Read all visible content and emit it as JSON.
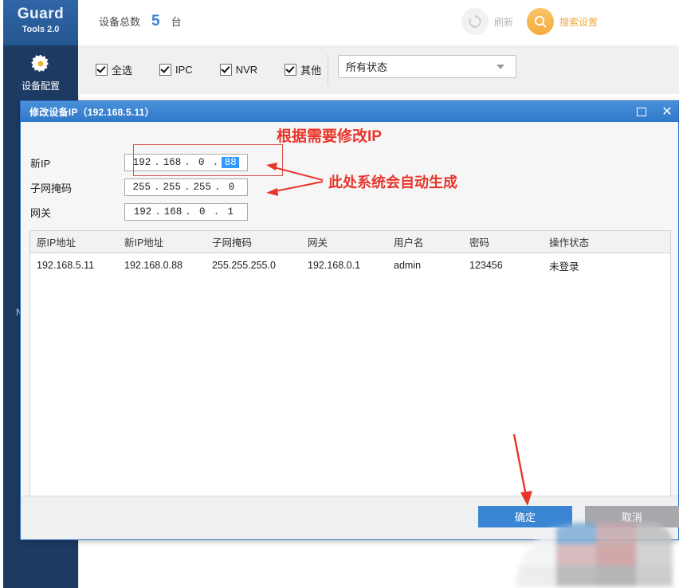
{
  "brand": {
    "title": "Guard",
    "subtitle": "Tools 2.0"
  },
  "header": {
    "device_count_label": "设备总数",
    "device_count_value": "5",
    "device_count_unit": "台",
    "refresh_label": "刷新",
    "search_setting_label": "搜索设置",
    "refresh_icon": "refresh-circular-arrow-icon",
    "search_icon": "search-settings-icon",
    "accent_blue": "#3a86d4",
    "accent_orange": "#f0a93c"
  },
  "sidebar": {
    "items": [
      {
        "label": "设备配置",
        "icon": "gear-icon"
      }
    ],
    "ghost_text": "NV",
    "background": "#1d3a63"
  },
  "filter_bar": {
    "checkboxes": [
      {
        "label": "全选",
        "checked": true
      },
      {
        "label": "IPC",
        "checked": true
      },
      {
        "label": "NVR",
        "checked": true
      },
      {
        "label": "其他",
        "checked": true
      }
    ],
    "status_select": {
      "value": "所有状态",
      "caret_icon": "chevron-down-icon"
    }
  },
  "dialog": {
    "title": "修改设备IP（192.168.5.11）",
    "titlebar_color": "#3b86d4",
    "window_controls": [
      {
        "name": "maximize",
        "icon": "maximize-icon"
      },
      {
        "name": "close",
        "icon": "close-icon"
      }
    ],
    "form": {
      "new_ip": {
        "label": "新IP",
        "octets": [
          "192",
          "168",
          "0",
          "88"
        ],
        "selected_octet_index": 3
      },
      "subnet_mask": {
        "label": "子网掩码",
        "octets": [
          "255",
          "255",
          "255",
          "0"
        ]
      },
      "gateway": {
        "label": "网关",
        "octets": [
          "192",
          "168",
          "0",
          "1"
        ]
      }
    },
    "table": {
      "columns": [
        "原IP地址",
        "新IP地址",
        "子网掩码",
        "网关",
        "用户名",
        "密码",
        "操作状态"
      ],
      "rows": [
        {
          "original_ip": "192.168.5.11",
          "new_ip": "192.168.0.88",
          "subnet_mask": "255.255.255.0",
          "gateway": "192.168.0.1",
          "username": "admin",
          "password": "123456",
          "status": "未登录"
        }
      ]
    },
    "footer": {
      "ok_label": "确定",
      "cancel_label": "取消",
      "ok_color": "#3b86d4",
      "cancel_color": "#a6a8ab"
    }
  },
  "annotations": {
    "color": "#e8352c",
    "modify_ip_note": "根据需要修改IP",
    "auto_generate_note": "此处系统会自动生成",
    "arrows": [
      {
        "name": "arrow-to-subnet-mask",
        "direction": "left"
      },
      {
        "name": "arrow-to-gateway",
        "direction": "left"
      },
      {
        "name": "arrow-to-ok-button",
        "direction": "down"
      }
    ]
  }
}
